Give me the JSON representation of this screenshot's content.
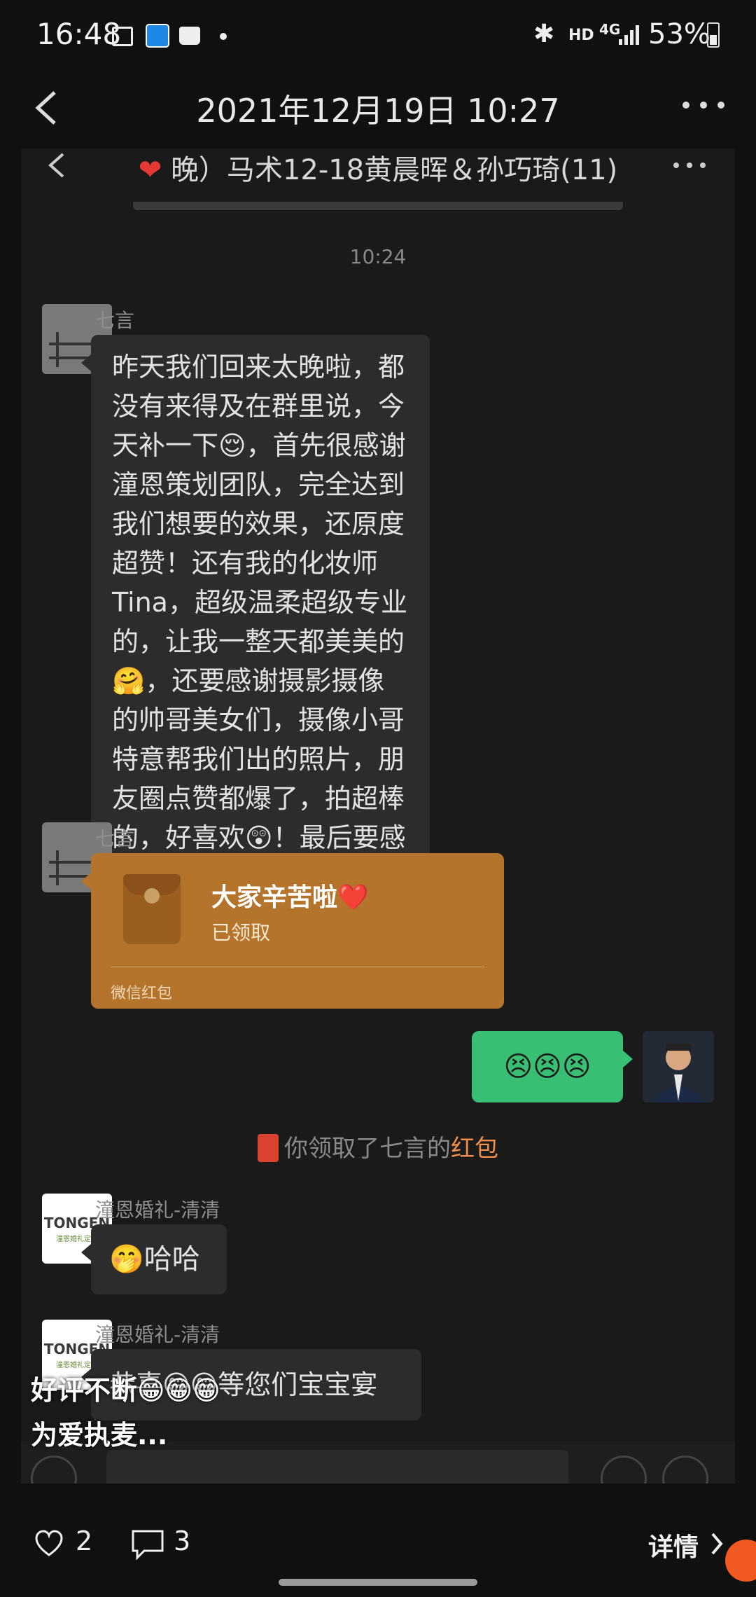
{
  "status_bar": {
    "time": "16:48",
    "right_text": "53%",
    "network": "4G",
    "hd": "HD"
  },
  "header": {
    "title": "2021年12月19日 10:27"
  },
  "chat": {
    "group_title": "晚）马术12-18黄晨晖＆孙巧琦(11)",
    "timestamp": "10:24",
    "messages": [
      {
        "sender": "七言",
        "text": "昨天我们回来太晚啦，都没有来得及在群里说，今天补一下😌，首先很感谢潼恩策划团队，完全达到我们想要的效果，还原度超赞！还有我的化妆师 Tina，超级温柔超级专业的，让我一整天都美美的🤗，还要感谢摄影摄像的帅哥美女们，摄像小哥特意帮我们出的照片，朋友圈点赞都爆了，拍超棒的，好喜欢😲！最后要感谢的就是主持人啦，是我喜欢的风格，多谢大家，辛苦啦！❤️🎉🎉"
      },
      {
        "sender": "七言",
        "redpacket_title": "大家辛苦啦❤️",
        "redpacket_status": "已领取",
        "redpacket_footer": "微信红包"
      },
      {
        "sender": "me",
        "text": "😣😣😣"
      },
      {
        "system_prefix": "你领取了七言的",
        "system_link": "红包"
      },
      {
        "sender": "潼恩婚礼-清清",
        "text": "🤭哈哈"
      },
      {
        "sender": "潼恩婚礼-清清",
        "text": "恭喜😁😁等您们宝宝宴"
      }
    ]
  },
  "caption": {
    "line1": "好评不断😁😁😁",
    "line2": "为爱执麦..."
  },
  "actions": {
    "likes": "2",
    "comments": "3",
    "details": "详情"
  },
  "logo_text": "TONGEN",
  "logo_sub": "潼恩婚礼定制",
  "colors": {
    "red_link": "#f0904a",
    "green": "#38bf73",
    "redpacket": "#b5742b"
  }
}
